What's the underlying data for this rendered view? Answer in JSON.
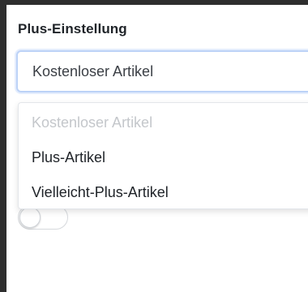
{
  "form": {
    "label": "Plus-Einstellung",
    "selected_value": "Kostenloser Artikel"
  },
  "dropdown": {
    "options": [
      {
        "label": "Kostenloser Artikel",
        "disabled": true
      },
      {
        "label": "Plus-Artikel",
        "disabled": false
      },
      {
        "label": "Vielleicht-Plus-Artikel",
        "disabled": false
      }
    ]
  },
  "toggle": {
    "checked": false
  },
  "colors": {
    "focus_border": "#bcd2f7",
    "disabled_text": "#c4c7cb",
    "text": "#1f2328",
    "background": "#2e2e2e"
  }
}
